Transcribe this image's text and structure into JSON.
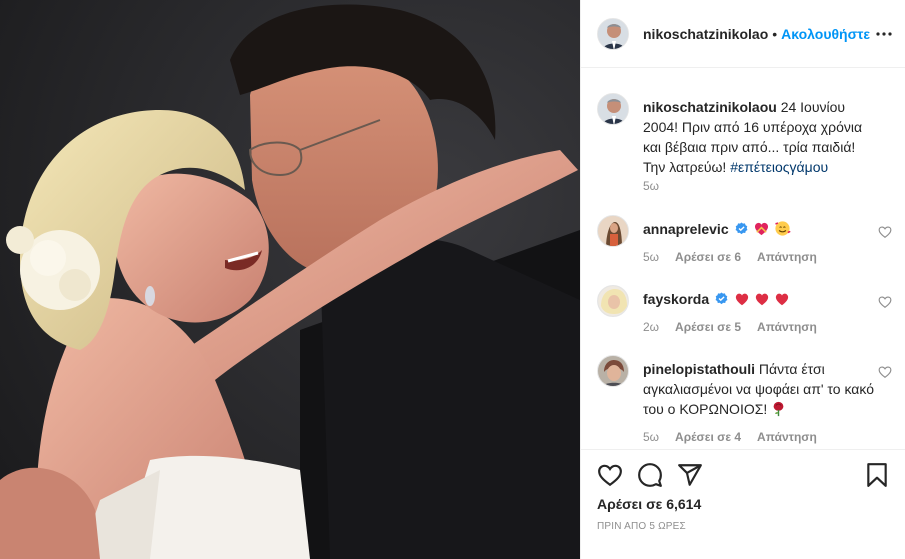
{
  "header": {
    "username": "nikoschatzinikolao",
    "separator": "•",
    "follow_label": "Ακολουθήστε",
    "more_icon": "more-horizontal-icon"
  },
  "caption": {
    "username": "nikoschatzinikolaou",
    "text": "24 Ιουνίου 2004! Πριν από 16 υπέροχα χρόνια και βέβαια πριν από... τρία παιδιά! Την λατρεύω!",
    "hashtag": "#επέτειοςγάμου",
    "age": "5ω"
  },
  "comments": [
    {
      "username": "annaprelevic",
      "verified": true,
      "text": "",
      "emojis": [
        "heart-with-ribbon",
        "smiling-face-with-hearts"
      ],
      "age": "5ω",
      "likes": "Αρέσει σε 6",
      "reply": "Απάντηση"
    },
    {
      "username": "fayskorda",
      "verified": true,
      "text": "",
      "emojis": [
        "red-heart",
        "red-heart",
        "red-heart"
      ],
      "age": "2ω",
      "likes": "Αρέσει σε 5",
      "reply": "Απάντηση"
    },
    {
      "username": "pinelopistathouli",
      "verified": false,
      "text": "Πάντα έτσι αγκαλιασμένοι να ψοφάει απ' το κακό του ο ΚΟΡΩΝΟΙΟΣ!",
      "emojis": [
        "rose"
      ],
      "age": "5ω",
      "likes": "Αρέσει σε 4",
      "reply": "Απάντηση"
    }
  ],
  "actions": {
    "icons": [
      "heart-icon",
      "comment-icon",
      "share-icon",
      "bookmark-icon"
    ],
    "likes_label": "Αρέσει σε 6,614",
    "timestamp": "ΠΡΙΝ ΑΠΟ 5 ΩΡΕΣ"
  },
  "colors": {
    "link_blue": "#0095f6",
    "hashtag": "#00376b",
    "meta_gray": "#8e8e8e",
    "text": "#262626",
    "heart_red": "#ed4956"
  }
}
